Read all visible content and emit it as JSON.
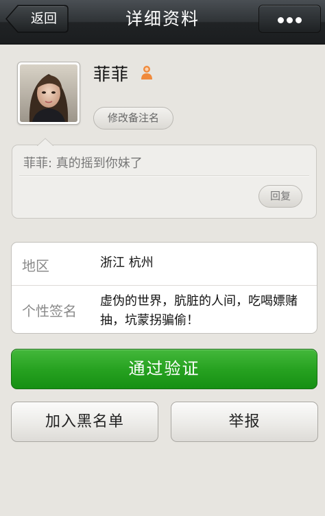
{
  "header": {
    "back_label": "返回",
    "title": "详细资料",
    "more_icon": "more-dots-icon"
  },
  "profile": {
    "nickname": "菲菲",
    "gender_icon": "female-user-icon",
    "gender_color": "#f08a3c",
    "remark_button": "修改备注名"
  },
  "message": {
    "text": "菲菲: 真的摇到你妹了",
    "reply_button": "回复"
  },
  "info": {
    "region_label": "地区",
    "region_value": "浙江 杭州",
    "signature_label": "个性签名",
    "signature_value": "虚伪的世界，肮脏的人间，吃喝嫖赌抽，坑蒙拐骗偷！"
  },
  "actions": {
    "verify": "通过验证",
    "blacklist": "加入黑名单",
    "report": "举报"
  },
  "colors": {
    "accent_green": "#27a221",
    "topbar": "#2f3336",
    "background": "#e7e5e0"
  }
}
